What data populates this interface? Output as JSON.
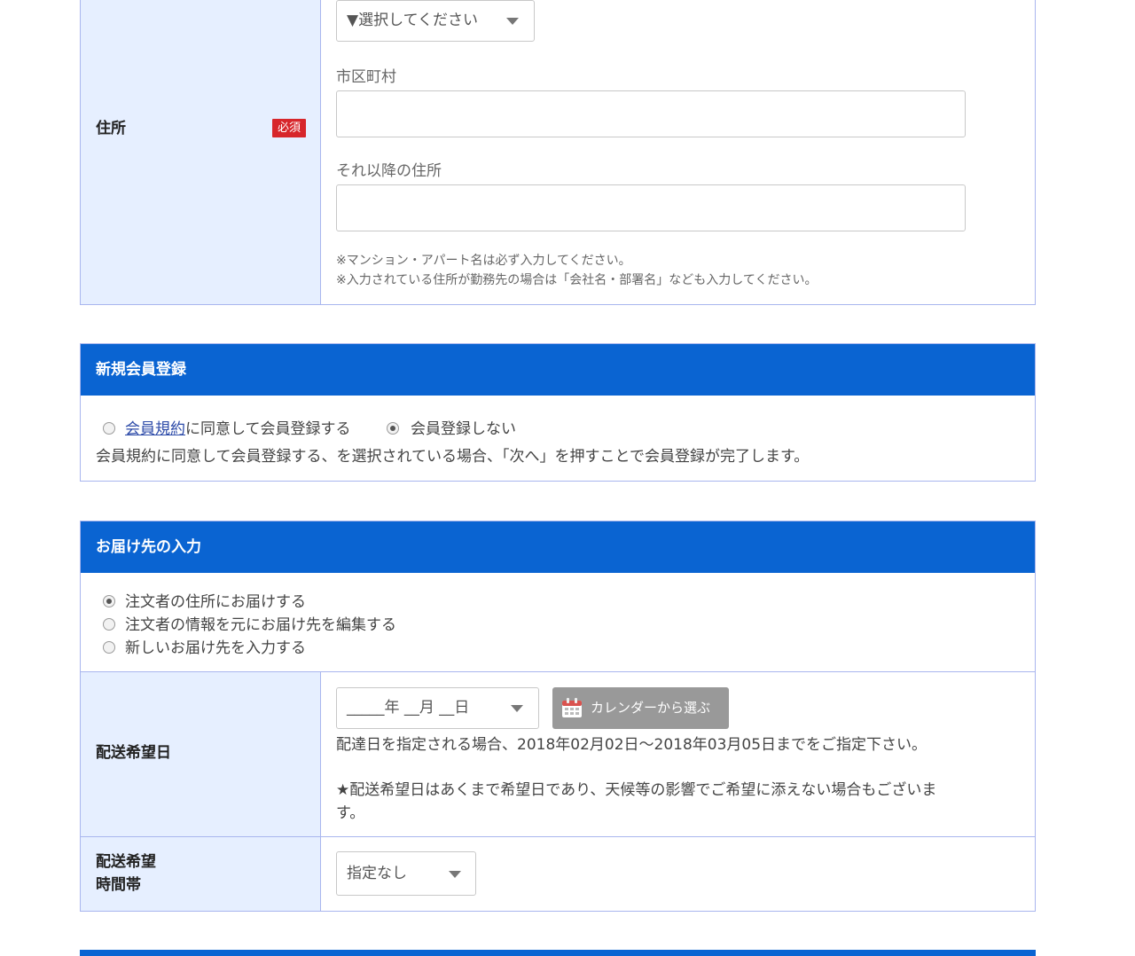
{
  "address": {
    "label": "住所",
    "required_badge": "必須",
    "prefecture_select": "▼選択してください",
    "city_label": "市区町村",
    "city_value": "",
    "rest_label": "それ以降の住所",
    "rest_value": "",
    "notes": [
      "※マンション・アパート名は必ず入力してください。",
      "※入力されている住所が勤務先の場合は「会社名・部署名」なども入力してください。"
    ]
  },
  "membership": {
    "title": "新規会員登録",
    "terms_link": "会員規約",
    "option_agree_rest": "に同意して会員登録する",
    "option_no": "会員登録しない",
    "selected": "no",
    "note": "会員規約に同意して会員登録する、を選択されている場合、「次へ」を押すことで会員登録が完了します。"
  },
  "delivery": {
    "title": "お届け先の入力",
    "options": [
      "注文者の住所にお届けする",
      "注文者の情報を元にお届け先を編集する",
      "新しいお届け先を入力する"
    ],
    "selected_index": 0,
    "date": {
      "label": "配送希望日",
      "select": "_____年 __月 __日",
      "calendar_button": "カレンダーから選ぶ",
      "note1": "配達日を指定される場合、2018年02月02日〜2018年03月05日までをご指定下さい。",
      "note2_line1": "★配送希望日はあくまで希望日であり、天候等の影響でご希望に添えない場合もございま",
      "note2_line2": "す。"
    },
    "time": {
      "label_line1": "配送希望",
      "label_line2": "時間帯",
      "select": "指定なし"
    }
  },
  "colors": {
    "header_blue": "#0a64d2",
    "label_bg": "#e6efff",
    "border": "#a9b6ee",
    "required_red": "#d7262b",
    "calendar_button": "#999999"
  }
}
